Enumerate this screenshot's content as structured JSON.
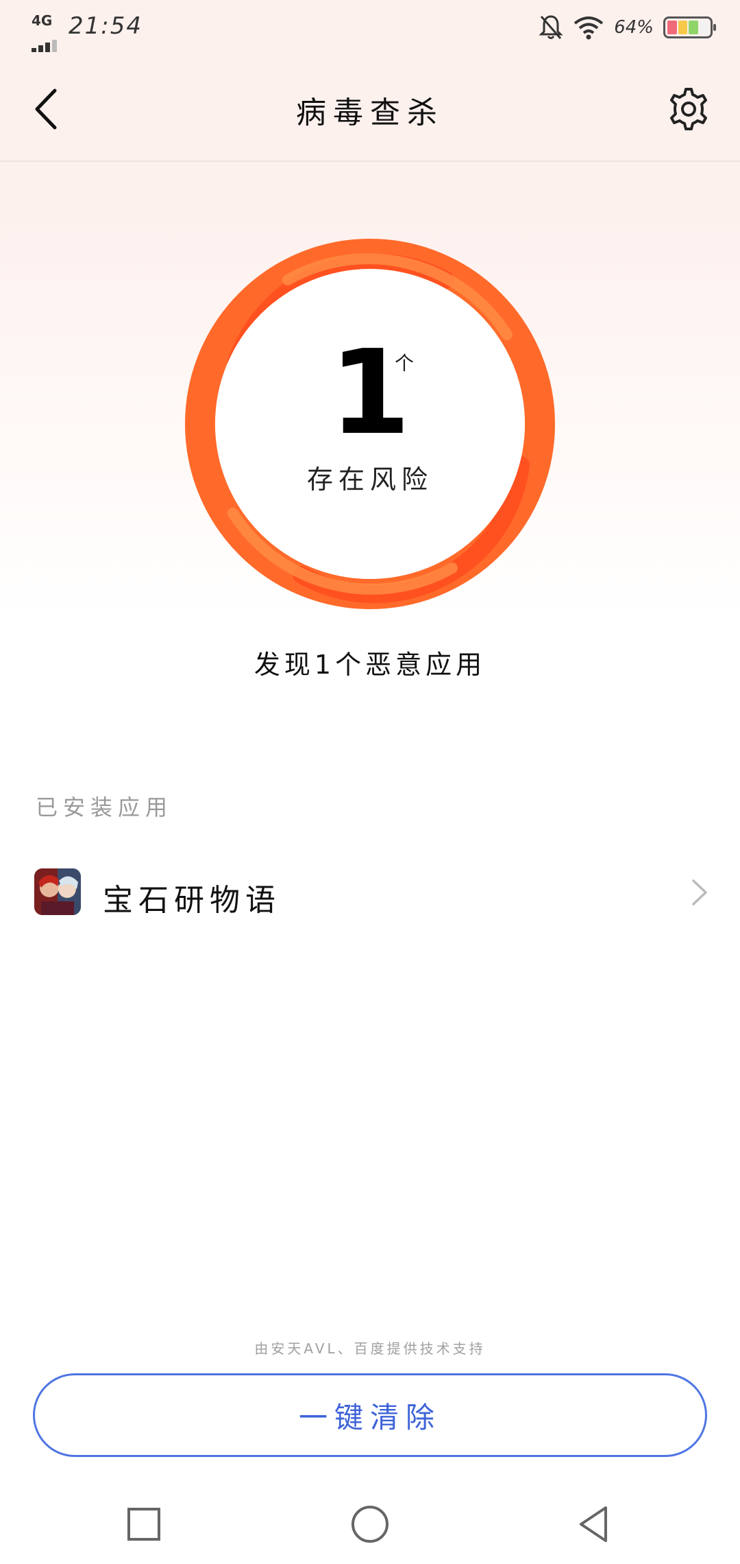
{
  "status_bar": {
    "network": "4G",
    "time": "21:54",
    "battery_percent": "64%"
  },
  "header": {
    "title": "病毒查杀"
  },
  "scan_result": {
    "count": "1",
    "unit": "个",
    "label": "存在风险",
    "ring_color_primary": "#ff5a1f",
    "ring_color_secondary": "#ff8a3d"
  },
  "summary": "发现1个恶意应用",
  "installed_section": {
    "title": "已安装应用",
    "items": [
      {
        "name": "宝石研物语"
      }
    ]
  },
  "tech_note": "由安天AVL、百度提供技术支持",
  "action_button": {
    "label": "一键清除",
    "color": "#4f75e3"
  }
}
